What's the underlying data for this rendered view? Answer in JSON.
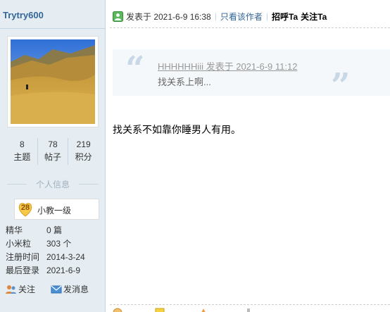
{
  "sidebar": {
    "username": "Trytry600",
    "stats": [
      {
        "num": "8",
        "label": "主题"
      },
      {
        "num": "78",
        "label": "帖子"
      },
      {
        "num": "219",
        "label": "积分"
      }
    ],
    "info_title": "个人信息",
    "level": {
      "num": "28",
      "label": "小教一级"
    },
    "profile": [
      {
        "key": "精华",
        "value": "0 篇"
      },
      {
        "key": "小米粒",
        "value": "303 个"
      },
      {
        "key": "注册时间",
        "value": "2014-3-24"
      },
      {
        "key": "最后登录",
        "value": "2021-6-9"
      }
    ],
    "actions": {
      "follow": "关注",
      "message": "发消息"
    }
  },
  "post": {
    "posted_at": "发表于 2021-6-9 16:38",
    "sep": "|",
    "only_author": "只看该作者",
    "greet": "招呼Ta",
    "follow": "关注Ta",
    "quote": {
      "meta": "HHHHHHiii 发表于 2021-6-9 11:12",
      "body": "找关系上啊..."
    },
    "body": "找关系不如靠你睡男人有用。"
  },
  "colors": {
    "sidebar_bg": "#e5edf2",
    "link": "#336699",
    "quote_bg": "#f5f8fa"
  }
}
